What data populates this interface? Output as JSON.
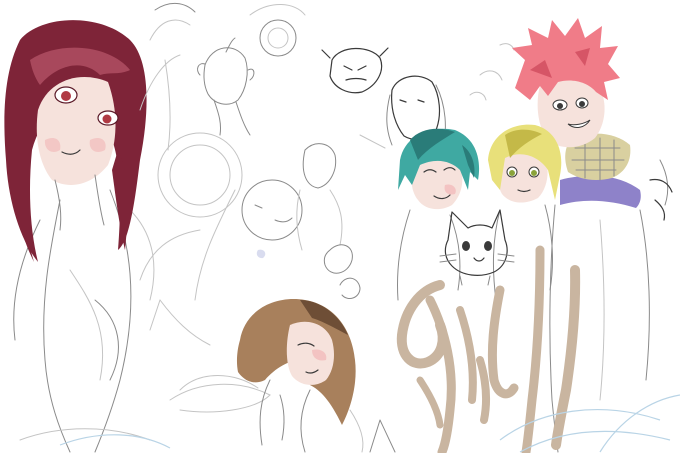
{
  "image": {
    "kind": "digital sketch collage of anime-style characters",
    "background": "#ffffff"
  },
  "colors": {
    "red_hair": "#7e2438",
    "red_hair_highlight": "#a8485c",
    "skin": "#f6e2dc",
    "blush": "#f2b6b6",
    "pink_hair": "#f07c88",
    "pink_hair_dark": "#d65566",
    "teal_hair": "#3fa9a2",
    "teal_hair_dark": "#2a7c79",
    "blonde_hair": "#e8e07a",
    "blonde_hair_dark": "#c4b948",
    "brown_hair": "#a8805c",
    "brown_hair_dark": "#6e4e36",
    "purple_coat": "#8e82c9",
    "scarf": "#d9d0a0",
    "tan_stroke": "#c9b5a0",
    "line_gray": "#8a8a8a"
  },
  "figures": [
    {
      "name": "red-haired-girl",
      "region": "left"
    },
    {
      "name": "pencil-sketch-girls",
      "region": "center-top"
    },
    {
      "name": "brown-haired-girl",
      "region": "bottom-center"
    },
    {
      "name": "teal-haired-girl",
      "region": "right"
    },
    {
      "name": "blonde-girl",
      "region": "right"
    },
    {
      "name": "pink-haired-boy",
      "region": "top-right"
    },
    {
      "name": "white-cat",
      "region": "right-center"
    },
    {
      "name": "tan-guide-strokes",
      "region": "bottom-right"
    }
  ]
}
